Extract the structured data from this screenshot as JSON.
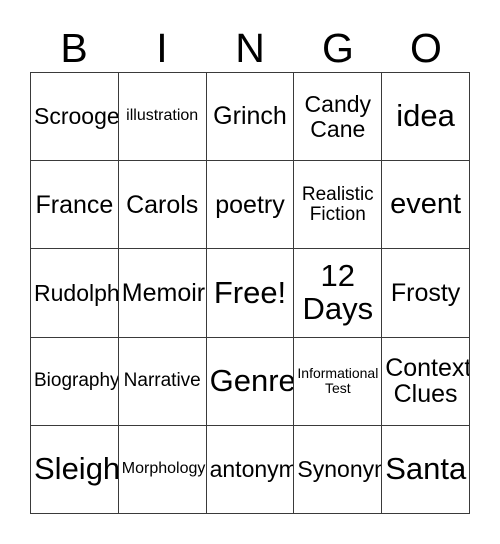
{
  "card": {
    "header": {
      "letters": [
        "B",
        "I",
        "N",
        "G",
        "O"
      ]
    },
    "grid": {
      "rows": 5,
      "columns": 5,
      "border_color": "#3a3a3a",
      "background_color": "#ffffff",
      "text_color": "#000000",
      "free_space": "Free!",
      "cells": [
        {
          "text": "Scrooge",
          "size": "m",
          "row": 1,
          "col": 1
        },
        {
          "text": "illustration",
          "size": "xs",
          "row": 1,
          "col": 2
        },
        {
          "text": "Grinch",
          "size": "l",
          "row": 1,
          "col": 3
        },
        {
          "text": "Candy\nCane",
          "size": "m",
          "row": 1,
          "col": 4
        },
        {
          "text": "idea",
          "size": "xxl",
          "row": 1,
          "col": 5
        },
        {
          "text": "France",
          "size": "l",
          "row": 2,
          "col": 1
        },
        {
          "text": "Carols",
          "size": "l",
          "row": 2,
          "col": 2
        },
        {
          "text": "poetry",
          "size": "l",
          "row": 2,
          "col": 3
        },
        {
          "text": "Realistic\nFiction",
          "size": "s",
          "row": 2,
          "col": 4
        },
        {
          "text": "event",
          "size": "xl",
          "row": 2,
          "col": 5
        },
        {
          "text": "Rudolph",
          "size": "m",
          "row": 3,
          "col": 1
        },
        {
          "text": "Memoir",
          "size": "l",
          "row": 3,
          "col": 2
        },
        {
          "text": "Free!",
          "size": "xxl",
          "row": 3,
          "col": 3
        },
        {
          "text": "12\nDays",
          "size": "xxl",
          "row": 3,
          "col": 4
        },
        {
          "text": "Frosty",
          "size": "l",
          "row": 3,
          "col": 5
        },
        {
          "text": "Biography",
          "size": "s",
          "row": 4,
          "col": 1
        },
        {
          "text": "Narrative",
          "size": "s",
          "row": 4,
          "col": 2
        },
        {
          "text": "Genre",
          "size": "xxl",
          "row": 4,
          "col": 3
        },
        {
          "text": "Informational\nTest",
          "size": "xxs",
          "row": 4,
          "col": 4
        },
        {
          "text": "Context\nClues",
          "size": "l",
          "row": 4,
          "col": 5
        },
        {
          "text": "Sleigh",
          "size": "xxl",
          "row": 5,
          "col": 1
        },
        {
          "text": "Morphology",
          "size": "xs",
          "row": 5,
          "col": 2
        },
        {
          "text": "antonym",
          "size": "m",
          "row": 5,
          "col": 3
        },
        {
          "text": "Synonym",
          "size": "m",
          "row": 5,
          "col": 4
        },
        {
          "text": "Santa",
          "size": "xxl",
          "row": 5,
          "col": 5
        }
      ]
    }
  }
}
